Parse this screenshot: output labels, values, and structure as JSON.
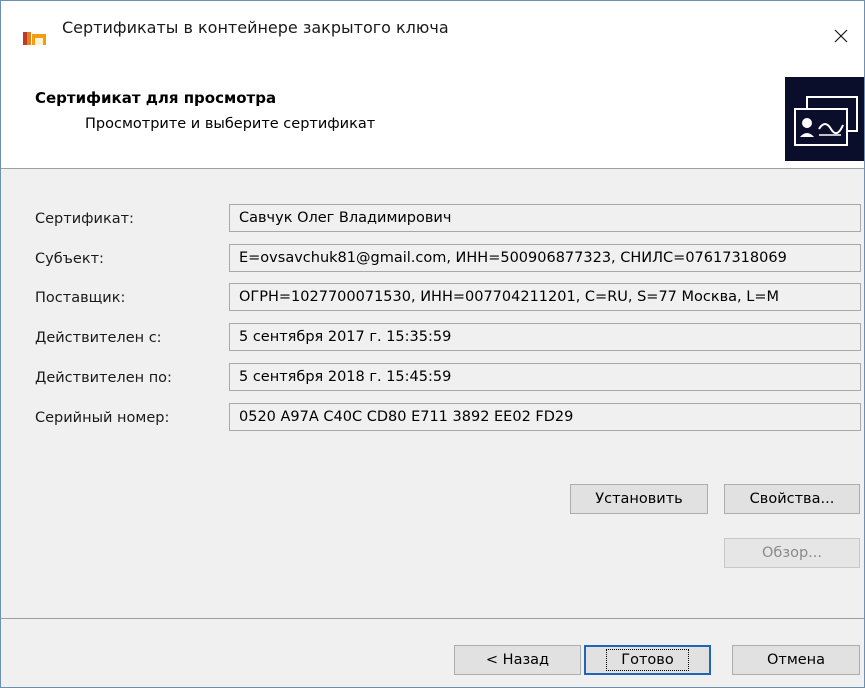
{
  "window": {
    "title": "Сертификаты в контейнере закрытого ключа"
  },
  "header": {
    "title": "Сертификат для просмотра",
    "subtitle": "Просмотрите и выберите сертификат"
  },
  "fields": {
    "certificate": {
      "label": "Сертификат:",
      "value": "Савчук Олег Владимирович"
    },
    "subject": {
      "label": "Субъект:",
      "value": "E=ovsavchuk81@gmail.com, ИНН=500906877323, СНИЛС=07617318069"
    },
    "issuer": {
      "label": "Поставщик:",
      "value": "ОГРН=1027700071530, ИНН=007704211201, C=RU, S=77 Москва, L=М"
    },
    "valid_from": {
      "label": "Действителен с:",
      "value": "5 сентября 2017 г. 15:35:59"
    },
    "valid_to": {
      "label": "Действителен по:",
      "value": "5 сентября 2018 г. 15:45:59"
    },
    "serial": {
      "label": "Серийный номер:",
      "value": "0520 A97A C40C CD80 E711 3892 EE02 FD29"
    }
  },
  "buttons": {
    "install": "Установить",
    "properties": "Свойства...",
    "browse": "Обзор...",
    "back": "< Назад",
    "finish": "Готово",
    "cancel": "Отмена"
  },
  "icons": {
    "app": "cryptopro-icon",
    "close": "close-icon",
    "header": "certificate-icon"
  }
}
